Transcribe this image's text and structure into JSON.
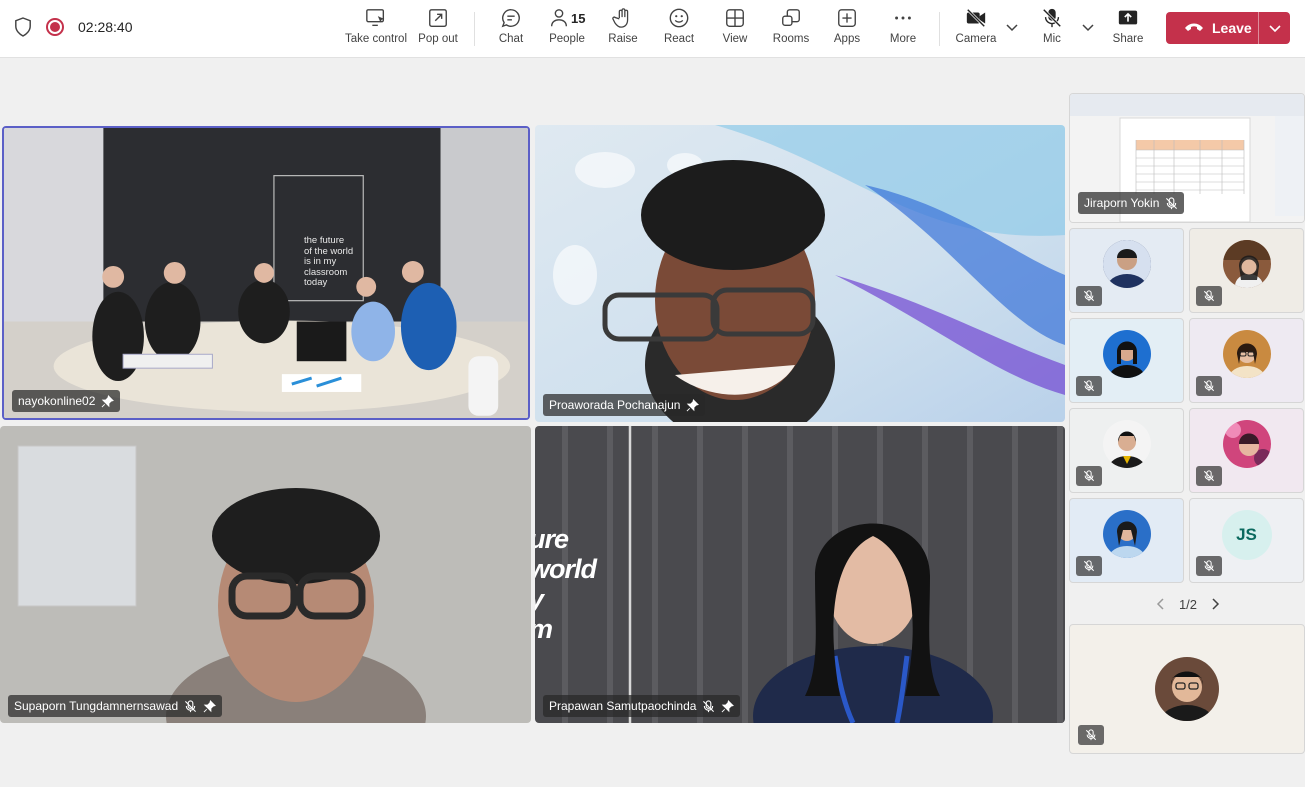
{
  "meeting": {
    "timer": "02:28:40"
  },
  "toolbar": {
    "take_control": "Take control",
    "pop_out": "Pop out",
    "chat": "Chat",
    "people": "People",
    "people_count": "15",
    "raise": "Raise",
    "react": "React",
    "view": "View",
    "rooms": "Rooms",
    "apps": "Apps",
    "more": "More",
    "camera": "Camera",
    "mic": "Mic",
    "share": "Share",
    "leave": "Leave"
  },
  "tiles": [
    {
      "name": "nayokonline02",
      "pinned": true,
      "muted": false
    },
    {
      "name": "Proaworada Pochanajun",
      "pinned": true,
      "muted": false
    },
    {
      "name": "Supaporn Tungdamnernsawad",
      "pinned": true,
      "muted": true
    },
    {
      "name": "Prapawan Samutpaochinda",
      "pinned": true,
      "muted": true
    }
  ],
  "screen_wall_text": [
    "the future",
    "of the world",
    "is in my",
    "classroom",
    "today"
  ],
  "back_wall_text": [
    "ure",
    "world",
    "y",
    "m"
  ],
  "rail": {
    "share_tile_name": "Jiraporn Yokin",
    "initials_tile": "JS",
    "pager": "1/2"
  },
  "colors": {
    "accent": "#5b5fc7",
    "leave": "#c4314b",
    "record": "#c4314b"
  }
}
